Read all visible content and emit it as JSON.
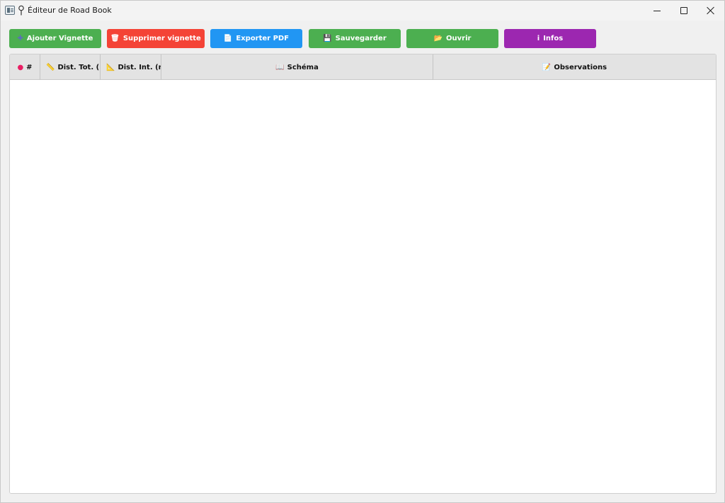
{
  "window": {
    "title": "Éditeur de Road Book"
  },
  "toolbar": {
    "buttons": [
      {
        "icon": "plus-icon",
        "glyph": "✚",
        "label": "Ajouter Vignette",
        "color": "#4caf50"
      },
      {
        "icon": "trash-icon",
        "glyph": "🗑",
        "label": "Supprimer vignette",
        "color": "#f44336"
      },
      {
        "icon": "document-icon",
        "glyph": "📄",
        "label": "Exporter PDF",
        "color": "#2196f3"
      },
      {
        "icon": "floppy-disk-icon",
        "glyph": "💾",
        "label": "Sauvegarder",
        "color": "#4caf50"
      },
      {
        "icon": "folder-icon",
        "glyph": "📂",
        "label": "Ouvrir",
        "color": "#4caf50"
      },
      {
        "icon": "info-icon",
        "glyph": "i",
        "label": "Infos",
        "color": "#9c27b0"
      }
    ]
  },
  "table": {
    "columns": [
      {
        "icon": "pin-icon",
        "glyph": "●",
        "label": "#"
      },
      {
        "icon": "ruler-icon",
        "glyph": "📏",
        "label": "Dist. Tot. (m"
      },
      {
        "icon": "triangular-ruler-icon",
        "glyph": "📐",
        "label": "Dist. Int. (m"
      },
      {
        "icon": "book-icon",
        "glyph": "📖",
        "label": "Schéma"
      },
      {
        "icon": "memo-icon",
        "glyph": "📝",
        "label": "Observations"
      }
    ],
    "rows": []
  }
}
